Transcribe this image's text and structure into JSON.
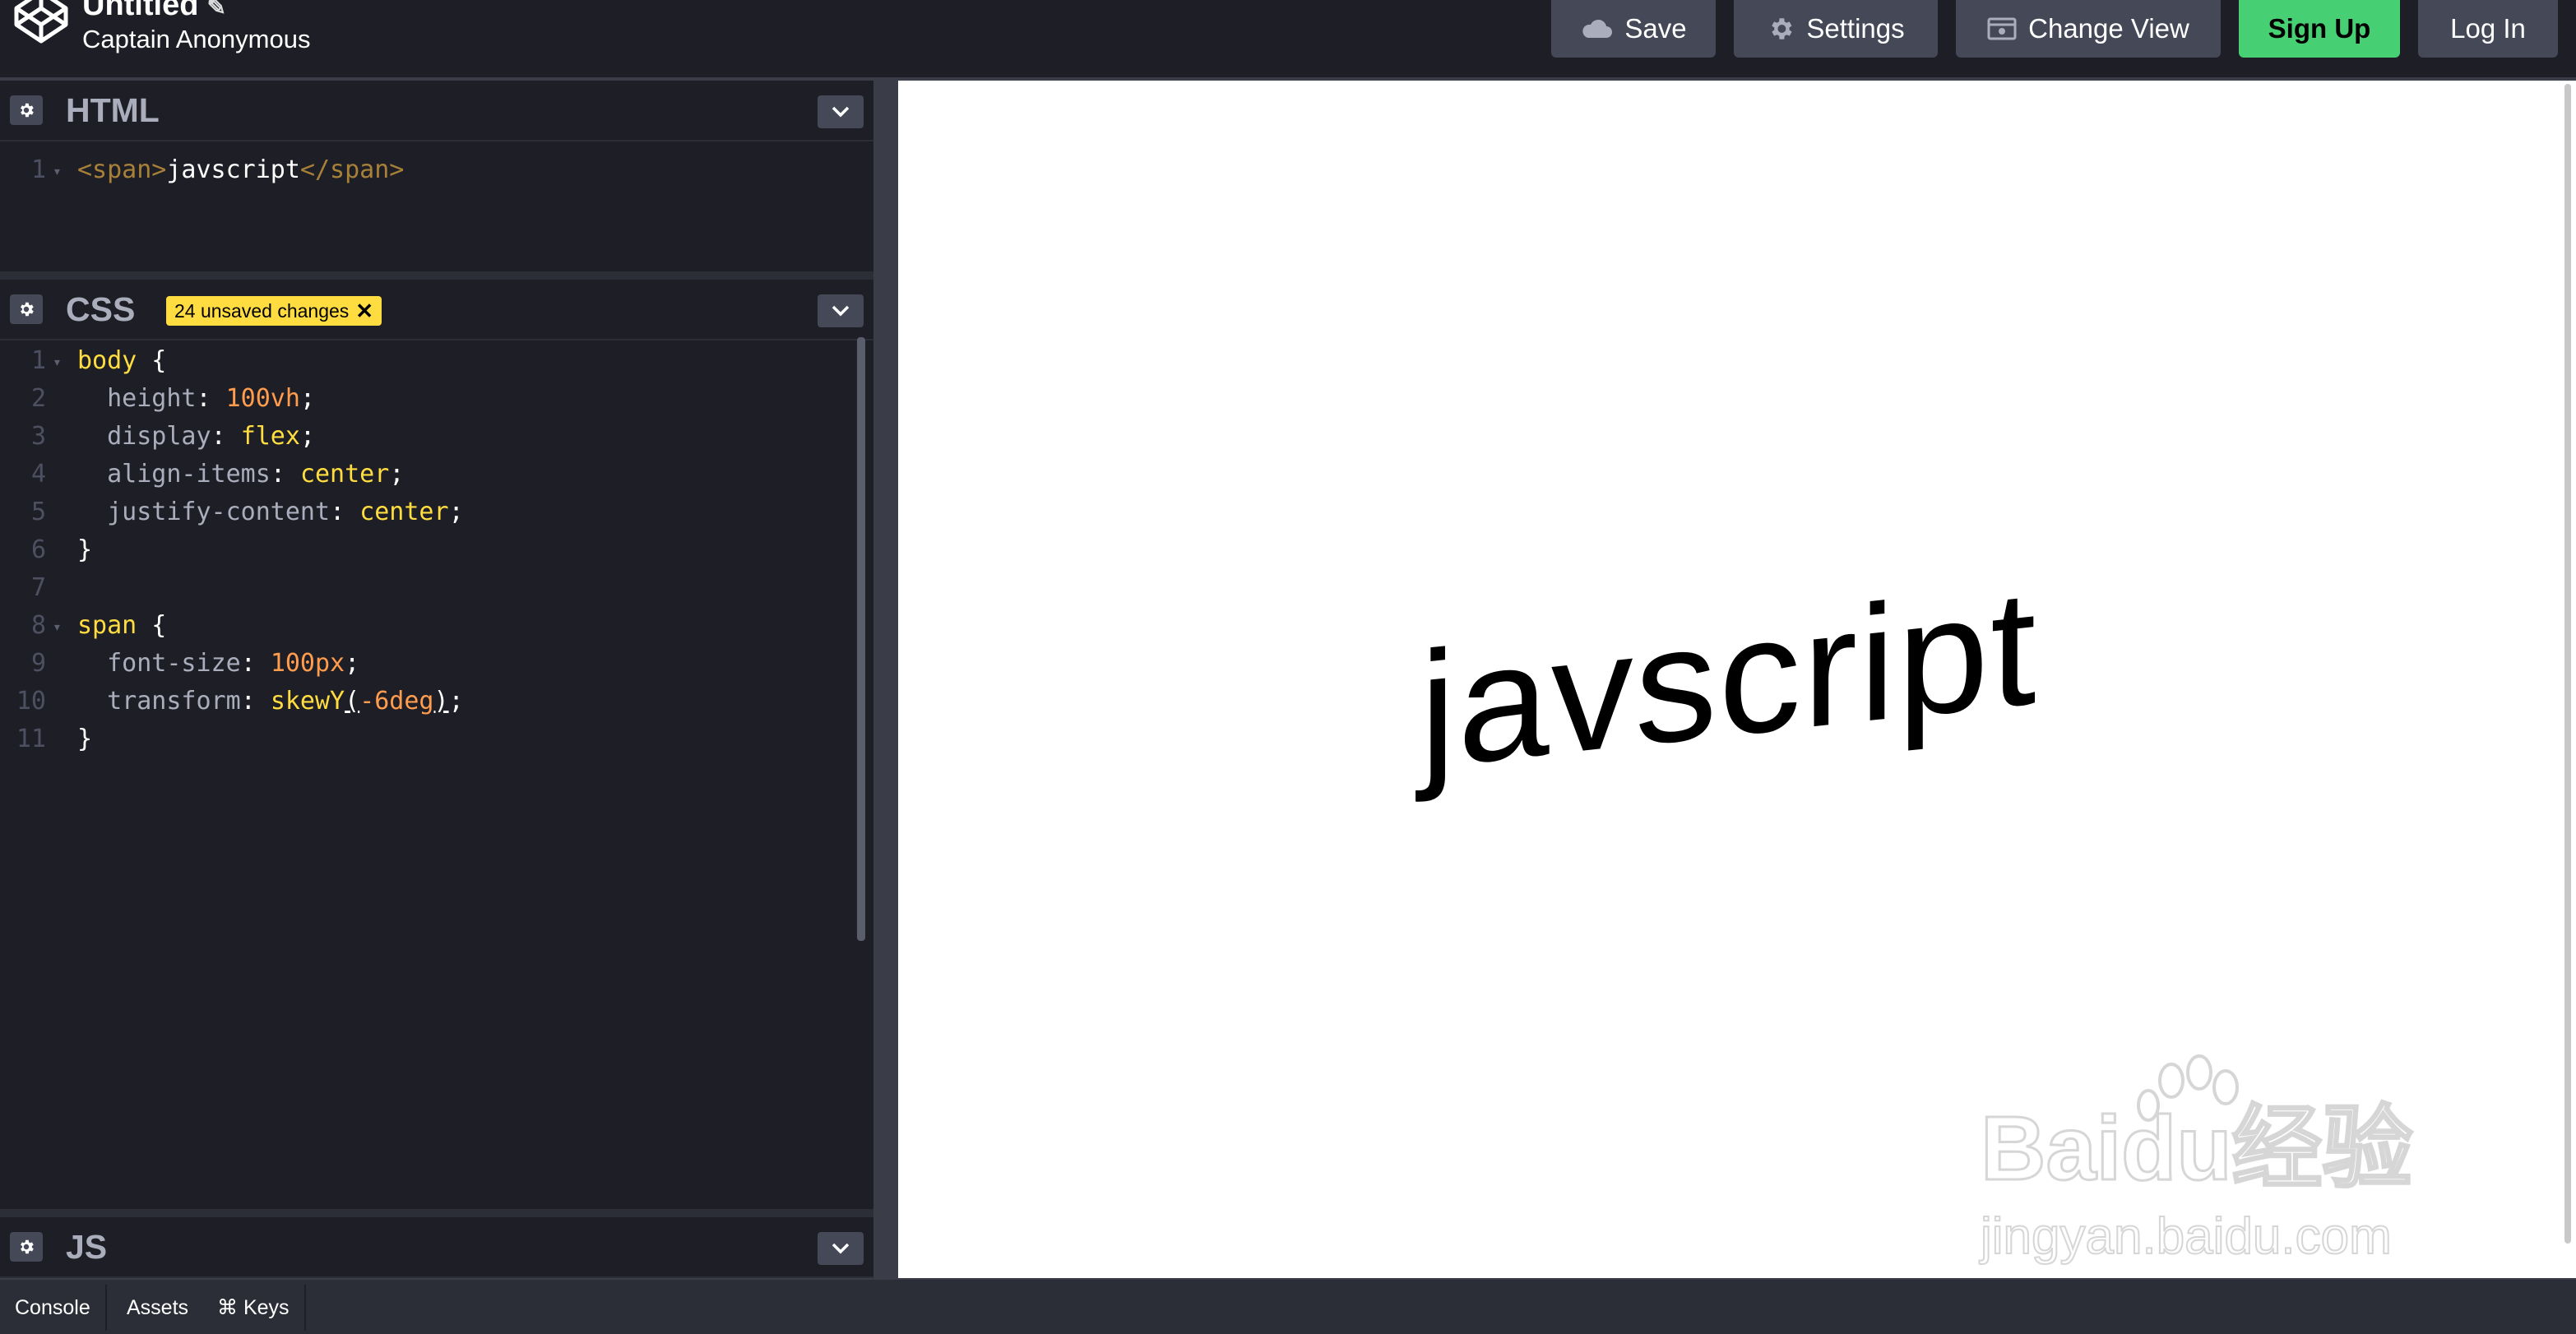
{
  "header": {
    "title": "Untitled",
    "author": "Captain Anonymous",
    "buttons": {
      "save": "Save",
      "settings": "Settings",
      "change_view": "Change View",
      "sign_up": "Sign Up",
      "log_in": "Log In"
    },
    "colors": {
      "signup": "#47cf73",
      "bar": "#1e1f26",
      "button": "#444857"
    }
  },
  "html_panel": {
    "title": "HTML",
    "lines": [
      {
        "n": "1",
        "code": "<span>javscript</span>"
      }
    ]
  },
  "css_panel": {
    "title": "CSS",
    "badge": "24 unsaved changes",
    "lines": [
      "1",
      "2",
      "3",
      "4",
      "5",
      "6",
      "7",
      "8",
      "9",
      "10",
      "11"
    ],
    "code": {
      "l1_sel": "body",
      "l1_brace": " {",
      "l2_prop": "height",
      "l2_val": "100vh",
      "l3_prop": "display",
      "l3_val": "flex",
      "l4_prop": "align-items",
      "l4_val": "center",
      "l5_prop": "justify-content",
      "l5_val": "center",
      "l6": "}",
      "l8_sel": "span",
      "l8_brace": " {",
      "l9_prop": "font-size",
      "l9_val": "100px",
      "l10_prop": "transform",
      "l10_fn": "skewY",
      "l10_val": "-6deg",
      "l11": "}"
    }
  },
  "js_panel": {
    "title": "JS"
  },
  "preview": {
    "text": "javscript",
    "watermark_main": "Baidu经验",
    "watermark_sub": "jingyan.baidu.com"
  },
  "footer": {
    "console": "Console",
    "assets": "Assets",
    "keys": "⌘ Keys"
  }
}
